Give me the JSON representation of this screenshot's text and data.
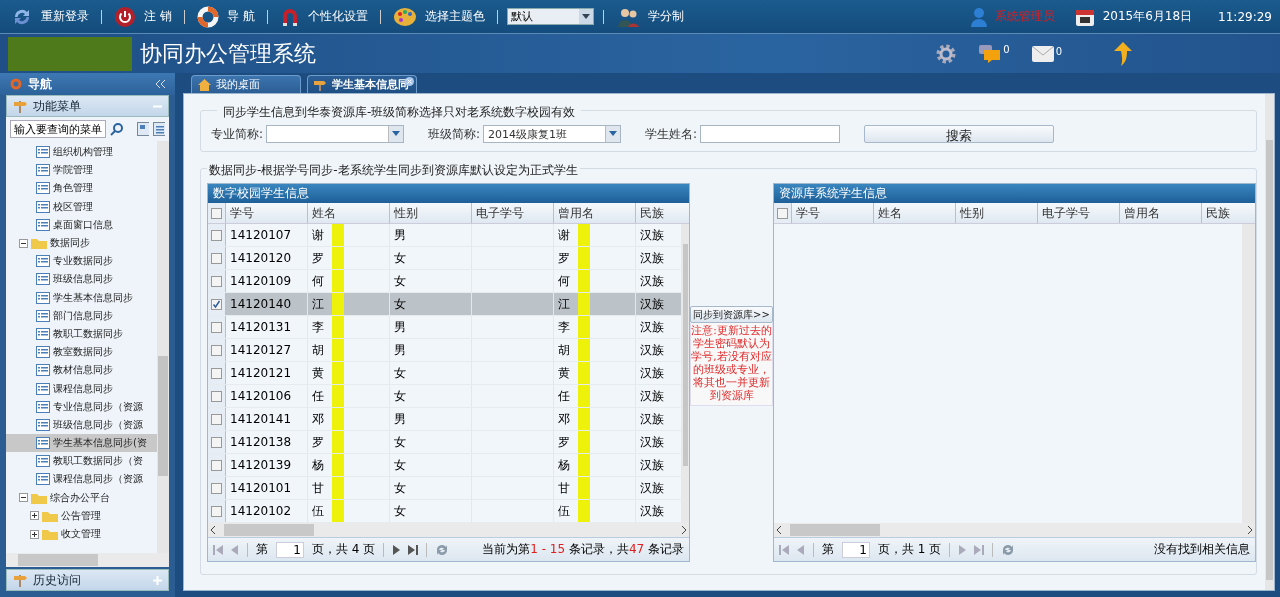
{
  "top_bar": {
    "links": [
      {
        "label": "重新登录",
        "kind": "refresh"
      },
      {
        "label": "注 销",
        "kind": "power"
      },
      {
        "label": "导 航",
        "kind": "lifebuoy"
      },
      {
        "label": "个性化设置",
        "kind": "magnet"
      },
      {
        "label": "选择主题色",
        "kind": "palette"
      }
    ],
    "theme_select": {
      "value": "默认"
    },
    "extra_link": {
      "label": "学分制",
      "kind": "people"
    },
    "user": "系统管理员",
    "date": "2015年6月18日",
    "time": "11:29:29"
  },
  "header": {
    "title": "协同办公管理系统",
    "message_count": "0",
    "mail_count": "0"
  },
  "sidebar": {
    "title": "导航",
    "panels": [
      {
        "title": "功能菜单",
        "expanded": true
      },
      {
        "title": "历史访问",
        "expanded": false
      }
    ],
    "search": {
      "value": "输入要查询的菜单"
    },
    "tree": [
      {
        "kind": "group",
        "children": [
          {
            "label": "组织机构管理",
            "selected": false
          },
          {
            "label": "学院管理",
            "selected": false
          },
          {
            "label": "角色管理",
            "selected": false
          },
          {
            "label": "校区管理",
            "selected": false
          },
          {
            "label": "桌面窗口信息",
            "selected": false
          }
        ]
      },
      {
        "label": "数据同步",
        "kind": "folder",
        "expanded": true,
        "children": [
          {
            "label": "专业数据同步",
            "selected": false
          },
          {
            "label": "班级信息同步",
            "selected": false
          },
          {
            "label": "学生基本信息同步",
            "selected": false
          },
          {
            "label": "部门信息同步",
            "selected": false
          },
          {
            "label": "教职工数据同步",
            "selected": false
          },
          {
            "label": "教室数据同步",
            "selected": false
          },
          {
            "label": "教材信息同步",
            "selected": false
          },
          {
            "label": "课程信息同步",
            "selected": false
          },
          {
            "label": "专业信息同步（资源",
            "selected": false
          },
          {
            "label": "班级信息同步（资源",
            "selected": false
          },
          {
            "label": "学生基本信息同步(资",
            "selected": true
          },
          {
            "label": "教职工数据同步（资",
            "selected": false
          },
          {
            "label": "课程信息同步（资源",
            "selected": false
          }
        ]
      },
      {
        "label": "综合办公平台",
        "kind": "folder",
        "expanded": true,
        "children": [
          {
            "label": "公告管理",
            "kind": "folder",
            "expanded": false
          },
          {
            "label": "收文管理",
            "kind": "folder",
            "expanded": false
          }
        ]
      }
    ]
  },
  "tabs": [
    {
      "label": "我的桌面",
      "selected": false,
      "closable": false
    },
    {
      "label": "学生基本信息同",
      "selected": true,
      "closable": true
    }
  ],
  "filter": {
    "legend": "同步学生信息到华泰资源库-班级简称选择只对老系统数字校园有效",
    "fields": [
      {
        "label": "专业简称:",
        "kind": "select"
      },
      {
        "label": "班级简称:",
        "kind": "select",
        "value": "2014级康复1班"
      },
      {
        "label": "学生姓名:",
        "kind": "text"
      }
    ],
    "button": "搜索"
  },
  "sync": {
    "legend": "数据同步-根据学号同步-老系统学生同步到资源库默认设定为正式学生",
    "button": "同步到资源库>>",
    "note": "注意:更新过去的学生密码默认为学号,若没有对应的班级或专业，将其也一并更新到资源库"
  },
  "left_grid": {
    "title": "数字校园学生信息",
    "all_checked": false,
    "columns": [
      "学号",
      "姓名",
      "性别",
      "电子学号",
      "曾用名",
      "民族"
    ],
    "rows": [
      {
        "cells": [
          "14120107",
          "谢",
          "男",
          "",
          "谢",
          "汉族"
        ],
        "checked": false
      },
      {
        "cells": [
          "14120120",
          "罗",
          "女",
          "",
          "罗",
          "汉族"
        ],
        "checked": false
      },
      {
        "cells": [
          "14120109",
          "何",
          "女",
          "",
          "何",
          "汉族"
        ],
        "checked": false
      },
      {
        "cells": [
          "14120140",
          "江",
          "女",
          "",
          "江",
          "汉族"
        ],
        "checked": true
      },
      {
        "cells": [
          "14120131",
          "李",
          "男",
          "",
          "李",
          "汉族"
        ],
        "checked": false
      },
      {
        "cells": [
          "14120127",
          "胡",
          "男",
          "",
          "胡",
          "汉族"
        ],
        "checked": false
      },
      {
        "cells": [
          "14120121",
          "黄",
          "女",
          "",
          "黄",
          "汉族"
        ],
        "checked": false
      },
      {
        "cells": [
          "14120106",
          "任",
          "女",
          "",
          "任",
          "汉族"
        ],
        "checked": false
      },
      {
        "cells": [
          "14120141",
          "邓",
          "男",
          "",
          "邓",
          "汉族"
        ],
        "checked": false
      },
      {
        "cells": [
          "14120138",
          "罗",
          "女",
          "",
          "罗",
          "汉族"
        ],
        "checked": false
      },
      {
        "cells": [
          "14120139",
          "杨",
          "女",
          "",
          "杨",
          "汉族"
        ],
        "checked": false
      },
      {
        "cells": [
          "14120101",
          "甘",
          "女",
          "",
          "甘",
          "汉族"
        ],
        "checked": false
      },
      {
        "cells": [
          "14120102",
          "伍",
          "女",
          "",
          "伍",
          "汉族"
        ],
        "checked": false
      }
    ],
    "pager": {
      "page_prefix": "第",
      "page": "1",
      "page_suffix": "页，共 4 页",
      "summary": [
        {
          "text": "当前为第",
          "highlight": false
        },
        {
          "text": "1 - 15",
          "highlight": true
        },
        {
          "text": " 条记录，共",
          "highlight": false
        },
        {
          "text": "47",
          "highlight": true
        },
        {
          "text": " 条记录",
          "highlight": false
        }
      ]
    }
  },
  "right_grid": {
    "title": "资源库系统学生信息",
    "all_checked": false,
    "columns": [
      "学号",
      "姓名",
      "性别",
      "电子学号",
      "曾用名",
      "民族"
    ],
    "pager": {
      "page_prefix": "第",
      "page": "1",
      "page_suffix": "页，共 1 页",
      "summary": [
        {
          "text": "没有找到相关信息",
          "highlight": false
        }
      ]
    }
  }
}
